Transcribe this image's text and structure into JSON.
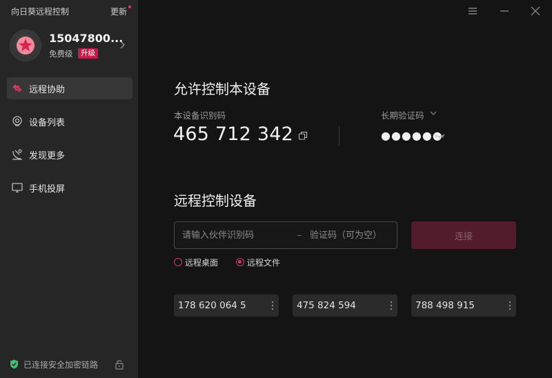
{
  "app": {
    "title": "向日葵远程控制",
    "update_label": "更新"
  },
  "profile": {
    "username": "15047800...",
    "tier": "免费级",
    "upgrade_label": "升级"
  },
  "sidebar": {
    "items": [
      {
        "label": "远程协助",
        "icon": "remote-assist-icon",
        "active": true
      },
      {
        "label": "设备列表",
        "icon": "device-list-icon",
        "active": false
      },
      {
        "label": "发现更多",
        "icon": "discover-icon",
        "active": false
      },
      {
        "label": "手机投屏",
        "icon": "screen-cast-icon",
        "active": false
      }
    ],
    "status_text": "已连接安全加密链路"
  },
  "allow_control": {
    "title": "允许控制本设备",
    "device_code_label": "本设备识别码",
    "device_code": "465 712 342",
    "verify_code_label": "长期验证码",
    "verify_code_masked": "●●●●●●"
  },
  "remote_control": {
    "title": "远程控制设备",
    "partner_placeholder": "请输入伙伴识别码",
    "code_placeholder": "验证码（可为空）",
    "connect_label": "连接",
    "modes": [
      {
        "label": "远程桌面",
        "checked": false
      },
      {
        "label": "远程文件",
        "checked": true
      }
    ],
    "history": [
      "178 620 064 5",
      "475 824 594",
      "788 498 915"
    ]
  },
  "colors": {
    "accent": "#d43a64",
    "upgrade_badge": "#c8184a",
    "connect_disabled": "#521c2c"
  }
}
